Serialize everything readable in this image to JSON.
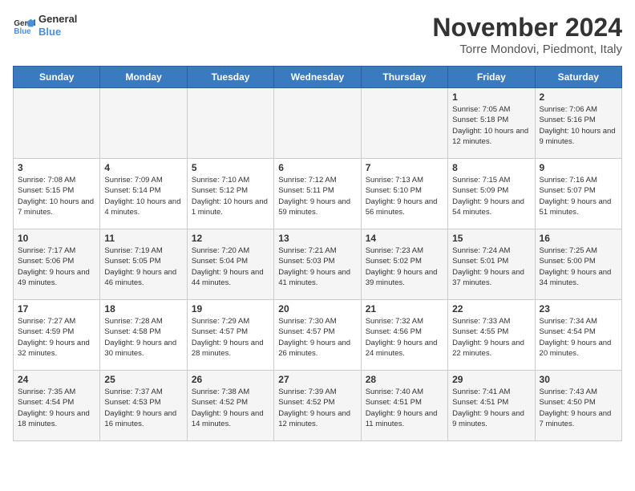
{
  "logo": {
    "line1": "General",
    "line2": "Blue"
  },
  "title": "November 2024",
  "subtitle": "Torre Mondovi, Piedmont, Italy",
  "headers": [
    "Sunday",
    "Monday",
    "Tuesday",
    "Wednesday",
    "Thursday",
    "Friday",
    "Saturday"
  ],
  "weeks": [
    [
      {
        "day": "",
        "info": ""
      },
      {
        "day": "",
        "info": ""
      },
      {
        "day": "",
        "info": ""
      },
      {
        "day": "",
        "info": ""
      },
      {
        "day": "",
        "info": ""
      },
      {
        "day": "1",
        "info": "Sunrise: 7:05 AM\nSunset: 5:18 PM\nDaylight: 10 hours and 12 minutes."
      },
      {
        "day": "2",
        "info": "Sunrise: 7:06 AM\nSunset: 5:16 PM\nDaylight: 10 hours and 9 minutes."
      }
    ],
    [
      {
        "day": "3",
        "info": "Sunrise: 7:08 AM\nSunset: 5:15 PM\nDaylight: 10 hours and 7 minutes."
      },
      {
        "day": "4",
        "info": "Sunrise: 7:09 AM\nSunset: 5:14 PM\nDaylight: 10 hours and 4 minutes."
      },
      {
        "day": "5",
        "info": "Sunrise: 7:10 AM\nSunset: 5:12 PM\nDaylight: 10 hours and 1 minute."
      },
      {
        "day": "6",
        "info": "Sunrise: 7:12 AM\nSunset: 5:11 PM\nDaylight: 9 hours and 59 minutes."
      },
      {
        "day": "7",
        "info": "Sunrise: 7:13 AM\nSunset: 5:10 PM\nDaylight: 9 hours and 56 minutes."
      },
      {
        "day": "8",
        "info": "Sunrise: 7:15 AM\nSunset: 5:09 PM\nDaylight: 9 hours and 54 minutes."
      },
      {
        "day": "9",
        "info": "Sunrise: 7:16 AM\nSunset: 5:07 PM\nDaylight: 9 hours and 51 minutes."
      }
    ],
    [
      {
        "day": "10",
        "info": "Sunrise: 7:17 AM\nSunset: 5:06 PM\nDaylight: 9 hours and 49 minutes."
      },
      {
        "day": "11",
        "info": "Sunrise: 7:19 AM\nSunset: 5:05 PM\nDaylight: 9 hours and 46 minutes."
      },
      {
        "day": "12",
        "info": "Sunrise: 7:20 AM\nSunset: 5:04 PM\nDaylight: 9 hours and 44 minutes."
      },
      {
        "day": "13",
        "info": "Sunrise: 7:21 AM\nSunset: 5:03 PM\nDaylight: 9 hours and 41 minutes."
      },
      {
        "day": "14",
        "info": "Sunrise: 7:23 AM\nSunset: 5:02 PM\nDaylight: 9 hours and 39 minutes."
      },
      {
        "day": "15",
        "info": "Sunrise: 7:24 AM\nSunset: 5:01 PM\nDaylight: 9 hours and 37 minutes."
      },
      {
        "day": "16",
        "info": "Sunrise: 7:25 AM\nSunset: 5:00 PM\nDaylight: 9 hours and 34 minutes."
      }
    ],
    [
      {
        "day": "17",
        "info": "Sunrise: 7:27 AM\nSunset: 4:59 PM\nDaylight: 9 hours and 32 minutes."
      },
      {
        "day": "18",
        "info": "Sunrise: 7:28 AM\nSunset: 4:58 PM\nDaylight: 9 hours and 30 minutes."
      },
      {
        "day": "19",
        "info": "Sunrise: 7:29 AM\nSunset: 4:57 PM\nDaylight: 9 hours and 28 minutes."
      },
      {
        "day": "20",
        "info": "Sunrise: 7:30 AM\nSunset: 4:57 PM\nDaylight: 9 hours and 26 minutes."
      },
      {
        "day": "21",
        "info": "Sunrise: 7:32 AM\nSunset: 4:56 PM\nDaylight: 9 hours and 24 minutes."
      },
      {
        "day": "22",
        "info": "Sunrise: 7:33 AM\nSunset: 4:55 PM\nDaylight: 9 hours and 22 minutes."
      },
      {
        "day": "23",
        "info": "Sunrise: 7:34 AM\nSunset: 4:54 PM\nDaylight: 9 hours and 20 minutes."
      }
    ],
    [
      {
        "day": "24",
        "info": "Sunrise: 7:35 AM\nSunset: 4:54 PM\nDaylight: 9 hours and 18 minutes."
      },
      {
        "day": "25",
        "info": "Sunrise: 7:37 AM\nSunset: 4:53 PM\nDaylight: 9 hours and 16 minutes."
      },
      {
        "day": "26",
        "info": "Sunrise: 7:38 AM\nSunset: 4:52 PM\nDaylight: 9 hours and 14 minutes."
      },
      {
        "day": "27",
        "info": "Sunrise: 7:39 AM\nSunset: 4:52 PM\nDaylight: 9 hours and 12 minutes."
      },
      {
        "day": "28",
        "info": "Sunrise: 7:40 AM\nSunset: 4:51 PM\nDaylight: 9 hours and 11 minutes."
      },
      {
        "day": "29",
        "info": "Sunrise: 7:41 AM\nSunset: 4:51 PM\nDaylight: 9 hours and 9 minutes."
      },
      {
        "day": "30",
        "info": "Sunrise: 7:43 AM\nSunset: 4:50 PM\nDaylight: 9 hours and 7 minutes."
      }
    ]
  ]
}
